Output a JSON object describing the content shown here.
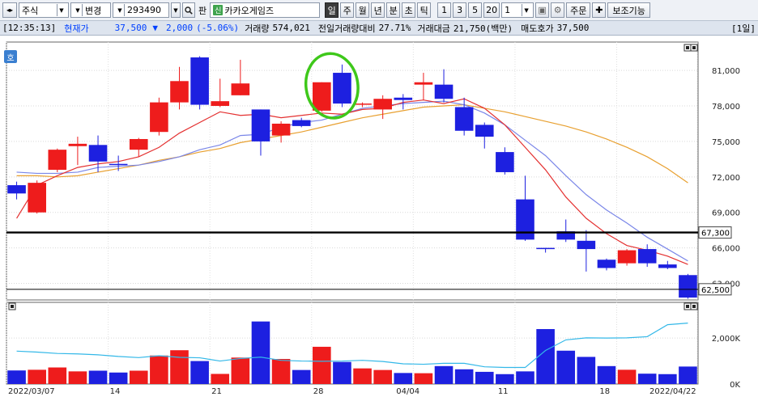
{
  "toolbar": {
    "market_select": "주식",
    "mode_select": "변경",
    "code_input": "293490",
    "pan_label": "판",
    "new_badge": "신",
    "stock_name": "카카오게임즈",
    "periods": [
      "일",
      "주",
      "월",
      "년",
      "분",
      "초",
      "틱"
    ],
    "active_period": "일",
    "minute_options": [
      "1",
      "3",
      "5",
      "20"
    ],
    "count_select": "1",
    "order_button": "주문",
    "aux_button": "보조기능"
  },
  "infobar": {
    "time": "[12:35:13]",
    "current_label": "현재가",
    "current_price": "37,500",
    "change_arrow": "▼",
    "change": "2,000",
    "change_pct": "(-5.06%)",
    "volume_label": "거래량",
    "volume": "574,021",
    "prev_volume_ratio_label": "전일거래량대비",
    "prev_volume_ratio": "27.71%",
    "amount_label": "거래대금",
    "amount": "21,750(백만)",
    "ask_label": "매도호가",
    "ask": "37,500",
    "period_tag": "[1일]"
  },
  "chart_data": {
    "type": "candlestick",
    "price_axis": {
      "ticks": [
        "81,000",
        "78,000",
        "75,000",
        "72,000",
        "69,000",
        "66,000",
        "63,000"
      ],
      "values": [
        81000,
        78000,
        75000,
        72000,
        69000,
        66000,
        63000
      ],
      "range": [
        61600,
        83400
      ]
    },
    "volume_axis": {
      "ticks": [
        "2,000K",
        "0K"
      ],
      "range": [
        0,
        3200
      ]
    },
    "x_tick_labels": [
      "2022/03/07",
      "14",
      "21",
      "28",
      "04/04",
      "11",
      "18",
      "2022/04/22"
    ],
    "horizontal_line_label": "67,300",
    "horizontal_line_value": 67300,
    "last_price_label": "62,500",
    "last_price_value": 62500,
    "candles": [
      {
        "o": 71300,
        "c": 70600,
        "h": 71600,
        "l": 70100,
        "v": 590,
        "up": false
      },
      {
        "o": 69000,
        "c": 71500,
        "h": 71700,
        "l": 68900,
        "v": 620,
        "up": true
      },
      {
        "o": 72600,
        "c": 74300,
        "h": 74400,
        "l": 72400,
        "v": 720,
        "up": true
      },
      {
        "o": 74600,
        "c": 74800,
        "h": 75400,
        "l": 73000,
        "v": 550,
        "up": true
      },
      {
        "o": 74700,
        "c": 73300,
        "h": 75500,
        "l": 72400,
        "v": 580,
        "up": false
      },
      {
        "o": 73000,
        "c": 73100,
        "h": 73800,
        "l": 72500,
        "v": 500,
        "up": false
      },
      {
        "o": 74300,
        "c": 75200,
        "h": 75300,
        "l": 73700,
        "v": 580,
        "up": true
      },
      {
        "o": 75800,
        "c": 78300,
        "h": 78700,
        "l": 75500,
        "v": 1240,
        "up": true
      },
      {
        "o": 78300,
        "c": 80100,
        "h": 81300,
        "l": 77700,
        "v": 1470,
        "up": true
      },
      {
        "o": 82100,
        "c": 78100,
        "h": 82200,
        "l": 77700,
        "v": 1000,
        "up": false
      },
      {
        "o": 78000,
        "c": 78400,
        "h": 80300,
        "l": 77900,
        "v": 440,
        "up": true
      },
      {
        "o": 78900,
        "c": 79900,
        "h": 81900,
        "l": 78900,
        "v": 1150,
        "up": true
      },
      {
        "o": 77700,
        "c": 75000,
        "h": 77700,
        "l": 73800,
        "v": 2720,
        "up": false
      },
      {
        "o": 75500,
        "c": 76500,
        "h": 76700,
        "l": 74900,
        "v": 1090,
        "up": true
      },
      {
        "o": 76800,
        "c": 76300,
        "h": 77000,
        "l": 76200,
        "v": 610,
        "up": false
      },
      {
        "o": 77600,
        "c": 80000,
        "h": 80000,
        "l": 77500,
        "v": 1620,
        "up": true
      },
      {
        "o": 80800,
        "c": 78200,
        "h": 81500,
        "l": 77900,
        "v": 960,
        "up": false
      },
      {
        "o": 78200,
        "c": 78200,
        "h": 78300,
        "l": 77900,
        "v": 680,
        "up": true
      },
      {
        "o": 77700,
        "c": 78600,
        "h": 78900,
        "l": 76900,
        "v": 610,
        "up": true
      },
      {
        "o": 78500,
        "c": 78700,
        "h": 79000,
        "l": 77700,
        "v": 480,
        "up": false
      },
      {
        "o": 79800,
        "c": 80000,
        "h": 80800,
        "l": 78500,
        "v": 470,
        "up": true
      },
      {
        "o": 79800,
        "c": 78600,
        "h": 81100,
        "l": 78300,
        "v": 780,
        "up": false
      },
      {
        "o": 77900,
        "c": 75900,
        "h": 78700,
        "l": 75500,
        "v": 640,
        "up": false
      },
      {
        "o": 76400,
        "c": 75400,
        "h": 76600,
        "l": 74400,
        "v": 530,
        "up": false
      },
      {
        "o": 74100,
        "c": 72400,
        "h": 74500,
        "l": 72200,
        "v": 430,
        "up": false
      },
      {
        "o": 70100,
        "c": 66700,
        "h": 72100,
        "l": 66600,
        "v": 550,
        "up": false
      },
      {
        "o": 66000,
        "c": 66000,
        "h": 66000,
        "l": 65600,
        "v": 2390,
        "up": false
      },
      {
        "o": 67400,
        "c": 66700,
        "h": 68400,
        "l": 66500,
        "v": 1450,
        "up": false
      },
      {
        "o": 66600,
        "c": 65900,
        "h": 67500,
        "l": 64000,
        "v": 1180,
        "up": false
      },
      {
        "o": 65000,
        "c": 64300,
        "h": 65100,
        "l": 64100,
        "v": 780,
        "up": false
      },
      {
        "o": 64700,
        "c": 65800,
        "h": 65900,
        "l": 64500,
        "v": 620,
        "up": true
      },
      {
        "o": 65900,
        "c": 64700,
        "h": 66300,
        "l": 64400,
        "v": 450,
        "up": false
      },
      {
        "o": 64600,
        "c": 64300,
        "h": 64900,
        "l": 64200,
        "v": 430,
        "up": false
      },
      {
        "o": 63700,
        "c": 61800,
        "h": 63800,
        "l": 61700,
        "v": 760,
        "up": false
      }
    ],
    "ma_short": [
      68500,
      71300,
      72100,
      72800,
      73100,
      73300,
      73700,
      74500,
      75700,
      76600,
      77500,
      77200,
      77300,
      77000,
      77200,
      77400,
      77300,
      77700,
      77800,
      78300,
      78500,
      78200,
      78600,
      77800,
      76400,
      74500,
      72600,
      70300,
      68500,
      67200,
      66200,
      65800,
      65300,
      64600
    ],
    "ma_mid": [
      72400,
      72300,
      72300,
      72400,
      72800,
      72900,
      73000,
      73300,
      73700,
      74300,
      74700,
      75500,
      75600,
      76200,
      76600,
      76800,
      77300,
      77800,
      78000,
      78200,
      78300,
      78400,
      78100,
      77400,
      76400,
      75100,
      73800,
      72100,
      70500,
      69200,
      68100,
      66900,
      65900,
      64900
    ],
    "ma_long": [
      72100,
      72100,
      72000,
      72100,
      72400,
      72700,
      73000,
      73400,
      73700,
      74100,
      74400,
      74900,
      75200,
      75500,
      75800,
      76200,
      76600,
      77000,
      77300,
      77600,
      77900,
      78000,
      78100,
      77800,
      77500,
      77100,
      76700,
      76300,
      75800,
      75200,
      74500,
      73700,
      72700,
      71500
    ],
    "volume_avg": [
      1430,
      1390,
      1330,
      1310,
      1270,
      1200,
      1150,
      1230,
      1160,
      1140,
      1000,
      1110,
      1170,
      1030,
      1000,
      990,
      1000,
      1030,
      980,
      880,
      860,
      900,
      900,
      750,
      720,
      720,
      1460,
      1920,
      2010,
      2000,
      2010,
      2060,
      2580,
      2650
    ]
  },
  "colors": {
    "up": "#ee1c1c",
    "down": "#1d20e0",
    "ma_short": "#e43030",
    "ma_mid": "#7a86e8",
    "ma_long": "#e8a030",
    "volume_avg": "#33b8e8",
    "annotation": "#3ec81a"
  }
}
